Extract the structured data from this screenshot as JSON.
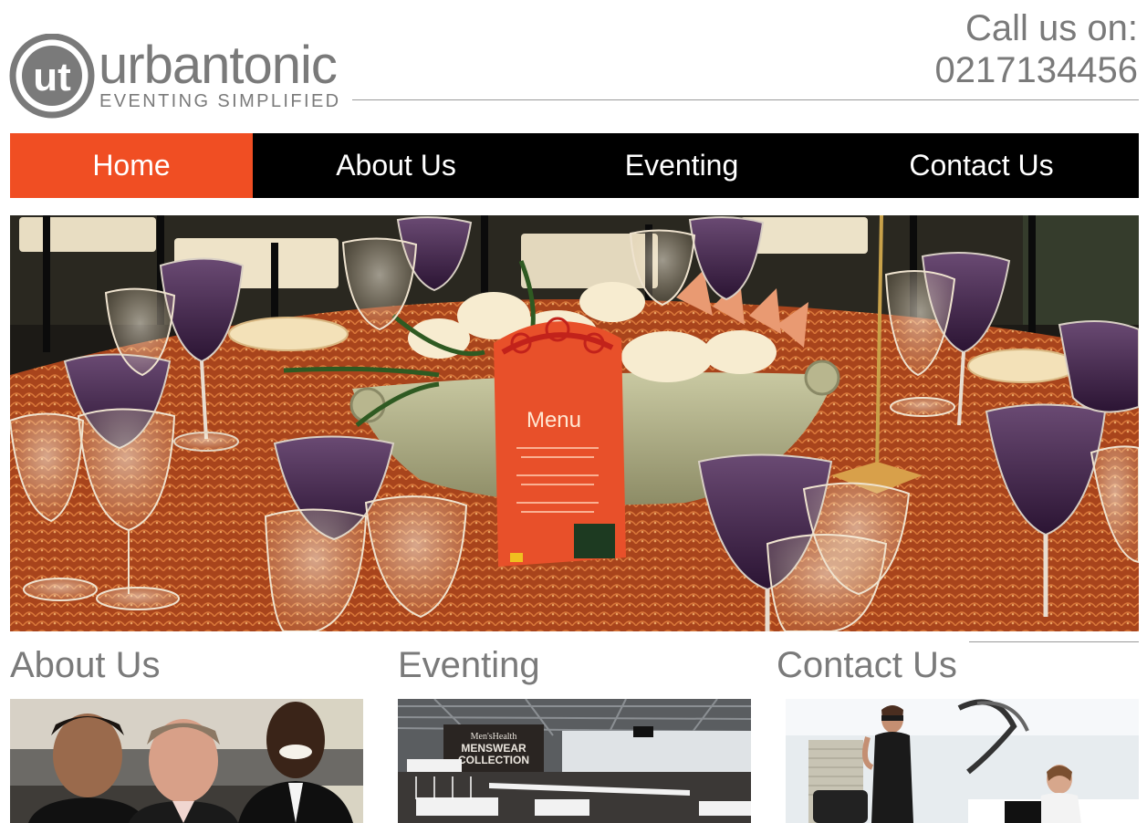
{
  "header": {
    "brand_mark": "ut",
    "brand_name": "urbantonic",
    "tagline": "EVENTING SIMPLIFIED",
    "call_label": "Call us on:",
    "phone": "0217134456"
  },
  "nav": {
    "items": [
      {
        "label": "Home",
        "active": true
      },
      {
        "label": "About Us",
        "active": false
      },
      {
        "label": "Eventing",
        "active": false
      },
      {
        "label": "Contact Us",
        "active": false
      }
    ]
  },
  "hero": {
    "menu_card_title": "Menu"
  },
  "sections": [
    {
      "title": "About Us"
    },
    {
      "title": "Eventing"
    },
    {
      "title": "Contact Us"
    }
  ],
  "eventing_thumb": {
    "banner_line1": "Men'sHealth",
    "banner_line2": "MENSWEAR",
    "banner_line3": "COLLECTION"
  },
  "colors": {
    "accent": "#f04e23",
    "nav_bg": "#000000",
    "brand_gray": "#7a7a7a"
  }
}
